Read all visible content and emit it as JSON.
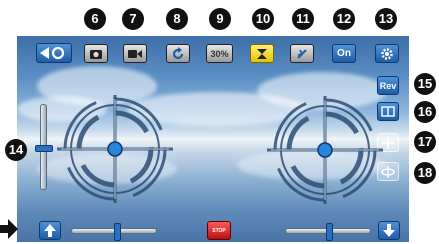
{
  "callouts": {
    "n6": "6",
    "n7": "7",
    "n8": "8",
    "n9": "9",
    "n10": "10",
    "n11": "11",
    "n12": "12",
    "n13": "13",
    "n14": "14",
    "n15": "15",
    "n16": "16",
    "n17": "17",
    "n18": "18"
  },
  "toolbar": {
    "photo_icon": "camera-icon",
    "video_icon": "video-camera-icon",
    "rotate_icon": "rotate-icon",
    "speed_label": "30%",
    "trim_icon": "hourglass-icon",
    "gravity_icon": "gravity-icon",
    "on_label": "On",
    "settings_icon": "gear-icon"
  },
  "side": {
    "rev_label": "Rev",
    "split_icon": "split-screen-icon",
    "headless_icon": "drone-icon",
    "flip_icon": "flip-icon"
  },
  "bottom": {
    "stop_label": "STOP"
  },
  "colors": {
    "accent_blue": "#1f5da6",
    "trim_yellow": "#f2d200",
    "stop_red": "#d42020"
  },
  "sliders": {
    "left_horizontal_position": 0.6,
    "right_horizontal_position": 0.5,
    "left_vertical_position": 0.5
  }
}
